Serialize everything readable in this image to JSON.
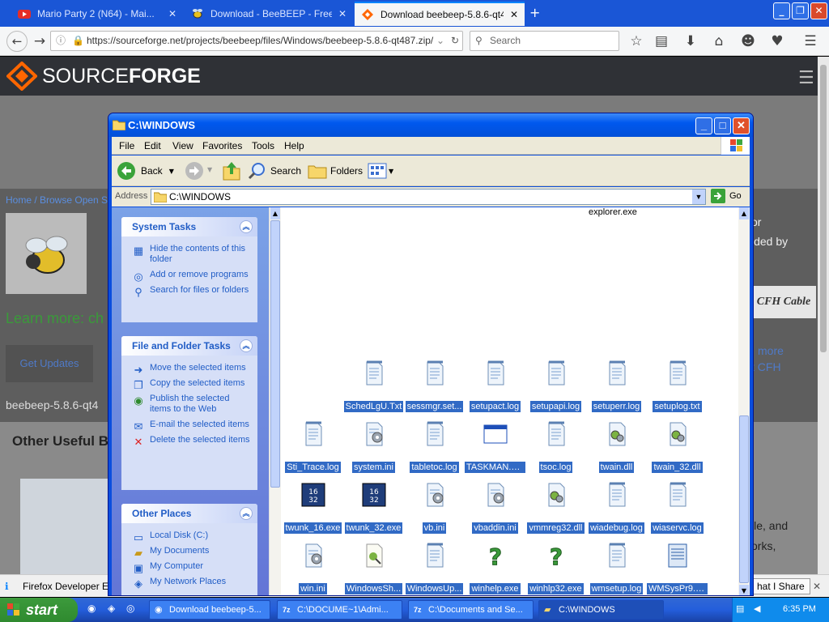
{
  "browser": {
    "tabs": [
      {
        "label": "Mario Party 2 (N64) - Mai...",
        "icon": "youtube-icon"
      },
      {
        "label": "Download - BeeBEEP - Free O...",
        "icon": "bee-icon"
      },
      {
        "label": "Download beebeep-5.8.6-qt4...",
        "icon": "sourceforge-icon"
      }
    ],
    "url": "https://sourceforge.net/projects/beebeep/files/Windows/beebeep-5.8.6-qt487.zip/",
    "search_placeholder": "Search"
  },
  "sf": {
    "logo_a": "SOURCE",
    "logo_b": "FORGE",
    "breadcrumb": "Home / Browse Open So",
    "learn_more": "Learn more: ch",
    "get_updates": "Get Updates",
    "filename": "beebeep-5.8.6-qt4",
    "other_useful": "Other Useful B",
    "right_or": "or",
    "right_ded": "ided by",
    "right_brand": "CFH Cable",
    "right_more": "more",
    "right_cfh": "t CFH",
    "right_file": "ile, and",
    "right_works": "orks,",
    "what_i_share": "hat I Share"
  },
  "notification": {
    "text": "Firefox Developer Edi"
  },
  "explorer": {
    "title": "C:\\WINDOWS",
    "menu": [
      "File",
      "Edit",
      "View",
      "Favorites",
      "Tools",
      "Help"
    ],
    "toolbar": {
      "back": "Back",
      "search": "Search",
      "folders": "Folders"
    },
    "address_label": "Address",
    "address": "C:\\WINDOWS",
    "go": "Go",
    "system_tasks": {
      "title": "System Tasks",
      "links": [
        "Hide the contents of this folder",
        "Add or remove programs",
        "Search for files or folders"
      ]
    },
    "file_tasks": {
      "title": "File and Folder Tasks",
      "links": [
        "Move the selected items",
        "Copy the selected items",
        "Publish the selected items to the Web",
        "E-mail the selected items",
        "Delete the selected items"
      ]
    },
    "other_places": {
      "title": "Other Places",
      "links": [
        "Local Disk (C:)",
        "My Documents",
        "My Computer",
        "My Network Places"
      ]
    },
    "top_file": "explorer.exe",
    "files": [
      {
        "name": "SchedLgU.Txt",
        "type": "text"
      },
      {
        "name": "sessmgr.set...",
        "type": "text"
      },
      {
        "name": "setupact.log",
        "type": "text"
      },
      {
        "name": "setupapi.log",
        "type": "text"
      },
      {
        "name": "setuperr.log",
        "type": "text"
      },
      {
        "name": "setuplog.txt",
        "type": "text"
      },
      {
        "name": "Sti_Trace.log",
        "type": "text"
      },
      {
        "name": "system.ini",
        "type": "ini"
      },
      {
        "name": "tabletoc.log",
        "type": "text"
      },
      {
        "name": "TASKMAN.EXE",
        "type": "exe"
      },
      {
        "name": "tsoc.log",
        "type": "text"
      },
      {
        "name": "twain.dll",
        "type": "dll"
      },
      {
        "name": "twain_32.dll",
        "type": "dll"
      },
      {
        "name": "twunk_16.exe",
        "type": "twunk"
      },
      {
        "name": "twunk_32.exe",
        "type": "twunk"
      },
      {
        "name": "vb.ini",
        "type": "ini"
      },
      {
        "name": "vbaddin.ini",
        "type": "ini"
      },
      {
        "name": "vmmreg32.dll",
        "type": "dll"
      },
      {
        "name": "wiadebug.log",
        "type": "text"
      },
      {
        "name": "wiaservc.log",
        "type": "text"
      },
      {
        "name": "win.ini",
        "type": "ini"
      },
      {
        "name": "WindowsSh...",
        "type": "shell"
      },
      {
        "name": "WindowsUp...",
        "type": "text"
      },
      {
        "name": "winhelp.exe",
        "type": "help"
      },
      {
        "name": "winhlp32.exe",
        "type": "help"
      },
      {
        "name": "wmsetup.log",
        "type": "text"
      },
      {
        "name": "WMSysPr9.prx",
        "type": "prx"
      }
    ]
  },
  "taskbar": {
    "start": "start",
    "items": [
      "Download beebeep-5...",
      "C:\\DOCUME~1\\Admi...",
      "C:\\Documents and Se...",
      "C:\\WINDOWS"
    ],
    "clock": "6:35 PM"
  }
}
